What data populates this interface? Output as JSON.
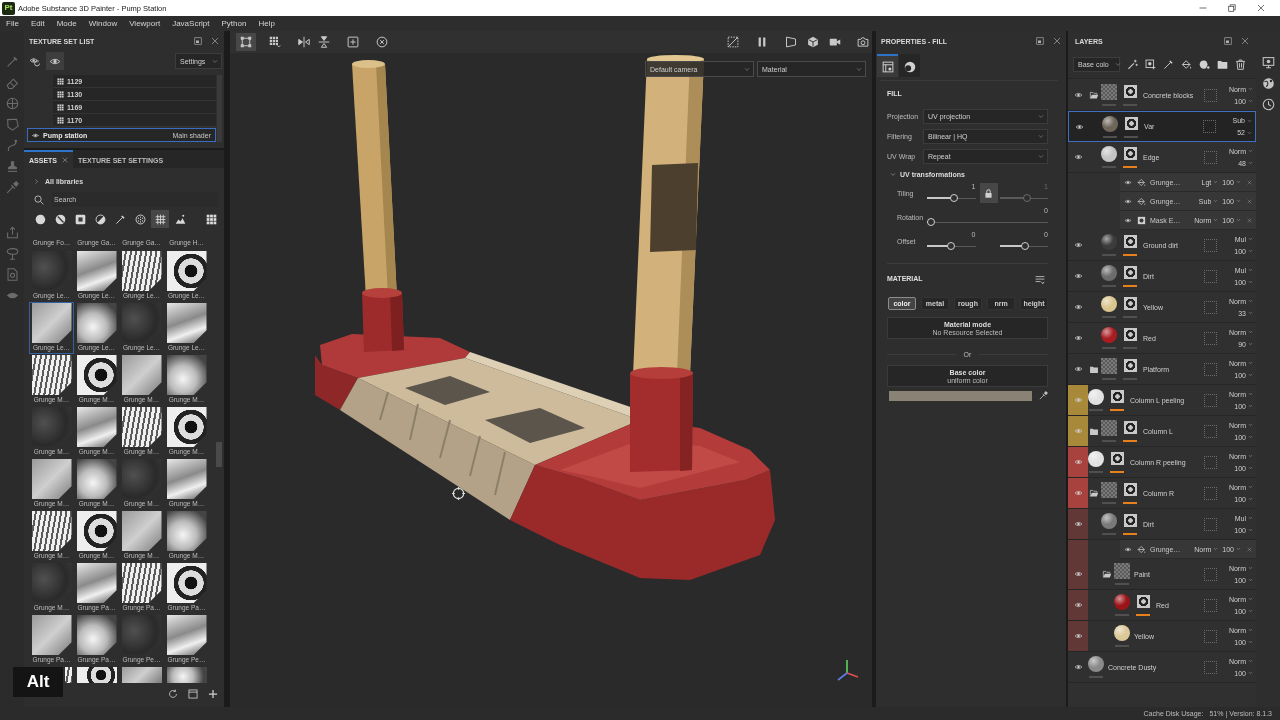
{
  "window": {
    "logo": "Pt",
    "title": "Adobe Substance 3D Painter - Pump Station"
  },
  "menu": [
    "File",
    "Edit",
    "Mode",
    "Window",
    "Viewport",
    "JavaScript",
    "Python",
    "Help"
  ],
  "texture_set_list": {
    "title": "TEXTURE SET LIST",
    "toolbar": [
      {
        "selected": false
      },
      {
        "selected": true
      }
    ],
    "settings": "Settings",
    "uv_tiles": [
      "1129",
      "1130",
      "1169",
      "1170"
    ],
    "texture_sets": [
      {
        "name": "Pump station",
        "shader": "Main shader",
        "selected": true
      }
    ]
  },
  "assets": {
    "tabs": [
      {
        "label": "ASSETS",
        "selected": true,
        "closable": true
      },
      {
        "label": "TEXTURE SET SETTINGS",
        "selected": false,
        "closable": false
      }
    ],
    "library": {
      "label": "All libraries",
      "expanded": false
    },
    "search": {
      "placeholder": "Search"
    },
    "filters": [
      {
        "selected": false
      },
      {
        "selected": false
      },
      {
        "selected": false
      },
      {
        "selected": false
      },
      {
        "selected": false
      },
      {
        "selected": false
      },
      {
        "selected": true
      },
      {
        "selected": false
      }
    ],
    "top_row_labels": [
      "Grunge Fo…",
      "Grunge Ga…",
      "Grunge Ga…",
      "Grunge H…"
    ],
    "items": [
      {
        "label": "Grunge Le…",
        "selected": false
      },
      {
        "label": "Grunge Le…",
        "selected": false
      },
      {
        "label": "Grunge Le…",
        "selected": false
      },
      {
        "label": "Grunge Le…",
        "selected": false
      },
      {
        "label": "Grunge Le…",
        "selected": true
      },
      {
        "label": "Grunge Le…",
        "selected": false
      },
      {
        "label": "Grunge Le…",
        "selected": false
      },
      {
        "label": "Grunge Le…",
        "selected": false
      },
      {
        "label": "Grunge M…",
        "selected": false
      },
      {
        "label": "Grunge M…",
        "selected": false
      },
      {
        "label": "Grunge M…",
        "selected": false
      },
      {
        "label": "Grunge M…",
        "selected": false
      },
      {
        "label": "Grunge M…",
        "selected": false
      },
      {
        "label": "Grunge M…",
        "selected": false
      },
      {
        "label": "Grunge M…",
        "selected": false
      },
      {
        "label": "Grunge M…",
        "selected": false
      },
      {
        "label": "Grunge M…",
        "selected": false
      },
      {
        "label": "Grunge M…",
        "selected": false
      },
      {
        "label": "Grunge M…",
        "selected": false
      },
      {
        "label": "Grunge M…",
        "selected": false
      },
      {
        "label": "Grunge M…",
        "selected": false
      },
      {
        "label": "Grunge M…",
        "selected": false
      },
      {
        "label": "Grunge M…",
        "selected": false
      },
      {
        "label": "Grunge M…",
        "selected": false
      },
      {
        "label": "Grunge M…",
        "selected": false
      },
      {
        "label": "Grunge Pa…",
        "selected": false
      },
      {
        "label": "Grunge Pa…",
        "selected": false
      },
      {
        "label": "Grunge Pa…",
        "selected": false
      },
      {
        "label": "Grunge Pa…",
        "selected": false
      },
      {
        "label": "Grunge Pa…",
        "selected": false
      },
      {
        "label": "Grunge Pe…",
        "selected": false
      },
      {
        "label": "Grunge Pe…",
        "selected": false
      },
      {
        "selected": false,
        "covered": true
      },
      {
        "selected": false
      },
      {
        "selected": false
      },
      {
        "selected": false
      }
    ]
  },
  "key_overlay": {
    "text": "Alt"
  },
  "viewport": {
    "tools": [
      {
        "selected": true
      },
      {
        "selected": false
      },
      {
        "selected": false
      },
      {
        "selected": false
      },
      {
        "selected": false
      },
      {
        "selected": false
      }
    ],
    "camera": "Default camera",
    "mode": "Material"
  },
  "properties": {
    "title": "PROPERTIES - FILL",
    "tabs": [
      {
        "selected": true
      },
      {
        "selected": false
      }
    ],
    "section": "FILL",
    "fields": [
      {
        "label": "Projection",
        "value": "UV projection"
      },
      {
        "label": "Filtering",
        "value": "Bilinear | HQ"
      },
      {
        "label": "UV Wrap",
        "value": "Repeat"
      }
    ],
    "uv_transformations": {
      "title": "UV transformations",
      "expanded": true,
      "rows": [
        {
          "label": "Tiling",
          "lock": {
            "on": true
          },
          "sliders": [
            {
              "reading": "1",
              "level": 0.58,
              "disabled": false
            },
            {
              "reading": "1",
              "level": 0.58,
              "disabled": true
            }
          ]
        },
        {
          "label": "Rotation",
          "sliders": [
            {
              "reading": "0",
              "level": 0,
              "disabled": false
            }
          ]
        },
        {
          "label": "Offset",
          "sliders": [
            {
              "reading": "0",
              "level": 0.5,
              "disabled": false
            },
            {
              "reading": "0",
              "level": 0.53,
              "disabled": false
            }
          ]
        }
      ]
    },
    "material": {
      "title": "MATERIAL",
      "channels": [
        {
          "label": "color",
          "on": true
        },
        {
          "label": "metal",
          "on": false
        },
        {
          "label": "rough",
          "on": false
        },
        {
          "label": "nrm",
          "on": false
        },
        {
          "label": "height",
          "on": false
        }
      ],
      "material_mode": {
        "title": "Material mode",
        "value": "No Resource Selected"
      },
      "separator": "Or",
      "base_color": {
        "title": "Base color",
        "value": "uniform color",
        "color": "#8a8375"
      }
    }
  },
  "layers": {
    "title": "LAYERS",
    "channel": "Base colo",
    "items": [
      {
        "kind": "folder",
        "name": "Concrete blocks",
        "visible": true,
        "selected": false,
        "expanded": true,
        "mask": true,
        "mask_highlighted": false,
        "blend": "Norm",
        "opacity": "100",
        "children": [
          {
            "kind": "fill",
            "name": "Var",
            "visible": true,
            "selected": true,
            "material": {
              "color": "#6e655b"
            },
            "mask": true,
            "mask_highlighted": false,
            "blend": "Sub",
            "opacity": "52"
          },
          {
            "kind": "fill",
            "name": "Edge",
            "visible": true,
            "selected": false,
            "material": {
              "color": "#c4c4c4"
            },
            "mask": true,
            "mask_highlighted": true,
            "blend": "Norm",
            "opacity": "48",
            "effects": [
              {
                "kind": "fill",
                "name": "Grunge…",
                "visible": true,
                "selected": false,
                "blend": "Lgt",
                "opacity": "100"
              },
              {
                "kind": "fill",
                "name": "Grunge…",
                "visible": true,
                "selected": false,
                "blend": "Sub",
                "opacity": "100"
              },
              {
                "kind": "mask",
                "name": "Mask E…",
                "visible": true,
                "selected": false,
                "blend": "Norm",
                "opacity": "100"
              }
            ]
          },
          {
            "kind": "fill",
            "name": "Ground dirt",
            "visible": true,
            "selected": false,
            "material": {
              "color": "#3c3c3c"
            },
            "mask": true,
            "mask_highlighted": true,
            "blend": "Mul",
            "opacity": "100"
          },
          {
            "kind": "fill",
            "name": "Dirt",
            "visible": true,
            "selected": false,
            "material": {
              "color": "#6c6c6c"
            },
            "mask": true,
            "mask_highlighted": true,
            "blend": "Mul",
            "opacity": "100"
          },
          {
            "kind": "fill",
            "name": "Yellow",
            "visible": true,
            "selected": false,
            "material": {
              "color": "#d9c58f"
            },
            "mask": true,
            "mask_highlighted": false,
            "blend": "Norm",
            "opacity": "33"
          },
          {
            "kind": "fill",
            "name": "Red",
            "visible": true,
            "selected": false,
            "material": {
              "color": "#a81c22"
            },
            "mask": true,
            "mask_highlighted": false,
            "blend": "Norm",
            "opacity": "90"
          }
        ]
      },
      {
        "kind": "folder",
        "name": "Platform",
        "visible": true,
        "selected": false,
        "expanded": false,
        "mask": true,
        "mask_highlighted": false,
        "blend": "Norm",
        "opacity": "100"
      },
      {
        "kind": "fill",
        "name": "Column L peeling",
        "visible": true,
        "selected": false,
        "color": "#a8893a",
        "material": {
          "color": "#e2e2e2"
        },
        "mask": true,
        "mask_highlighted": true,
        "blend": "Norm",
        "opacity": "100"
      },
      {
        "kind": "folder",
        "name": "Column L",
        "visible": true,
        "selected": false,
        "expanded": false,
        "color": "#a8893a",
        "mask": true,
        "mask_highlighted": true,
        "blend": "Norm",
        "opacity": "100"
      },
      {
        "kind": "fill",
        "name": "Column R peeling",
        "visible": true,
        "selected": false,
        "color": "#a8423e",
        "material": {
          "color": "#e2e2e2"
        },
        "mask": true,
        "mask_highlighted": true,
        "blend": "Norm",
        "opacity": "100"
      },
      {
        "kind": "folder",
        "name": "Column R",
        "visible": true,
        "selected": false,
        "expanded": true,
        "color": "#a8423e",
        "mask": true,
        "mask_highlighted": true,
        "blend": "Norm",
        "opacity": "100",
        "children": [
          {
            "kind": "fill",
            "name": "Dirt",
            "visible": true,
            "selected": false,
            "material": {
              "color": "#7a7a7a"
            },
            "mask": true,
            "mask_highlighted": true,
            "blend": "Mul",
            "opacity": "100",
            "effects": [
              {
                "kind": "fill",
                "name": "Grunge…",
                "visible": true,
                "selected": false,
                "blend": "Norm",
                "opacity": "100"
              }
            ]
          },
          {
            "kind": "folder",
            "name": "Paint",
            "visible": true,
            "selected": false,
            "expanded": true,
            "mask": false,
            "blend": "Norm",
            "opacity": "100",
            "children": [
              {
                "kind": "fill",
                "name": "Red",
                "visible": true,
                "selected": false,
                "material": {
                  "color": "#9c1418"
                },
                "mask": true,
                "mask_highlighted": true,
                "blend": "Norm",
                "opacity": "100"
              },
              {
                "kind": "fill",
                "name": "Yellow",
                "visible": true,
                "selected": false,
                "material": {
                  "color": "#dcc999"
                },
                "mask": false,
                "blend": "Norm",
                "opacity": "100"
              }
            ]
          }
        ]
      },
      {
        "kind": "fill",
        "name": "Concrete Dusty",
        "visible": true,
        "selected": false,
        "material": {
          "color": "#8a8a8a"
        },
        "mask": false,
        "blend": "Norm",
        "opacity": "100"
      }
    ]
  },
  "status_bar": {
    "label": "Cache Disk Usage:",
    "value": "51% | Version: 8.1.3"
  }
}
